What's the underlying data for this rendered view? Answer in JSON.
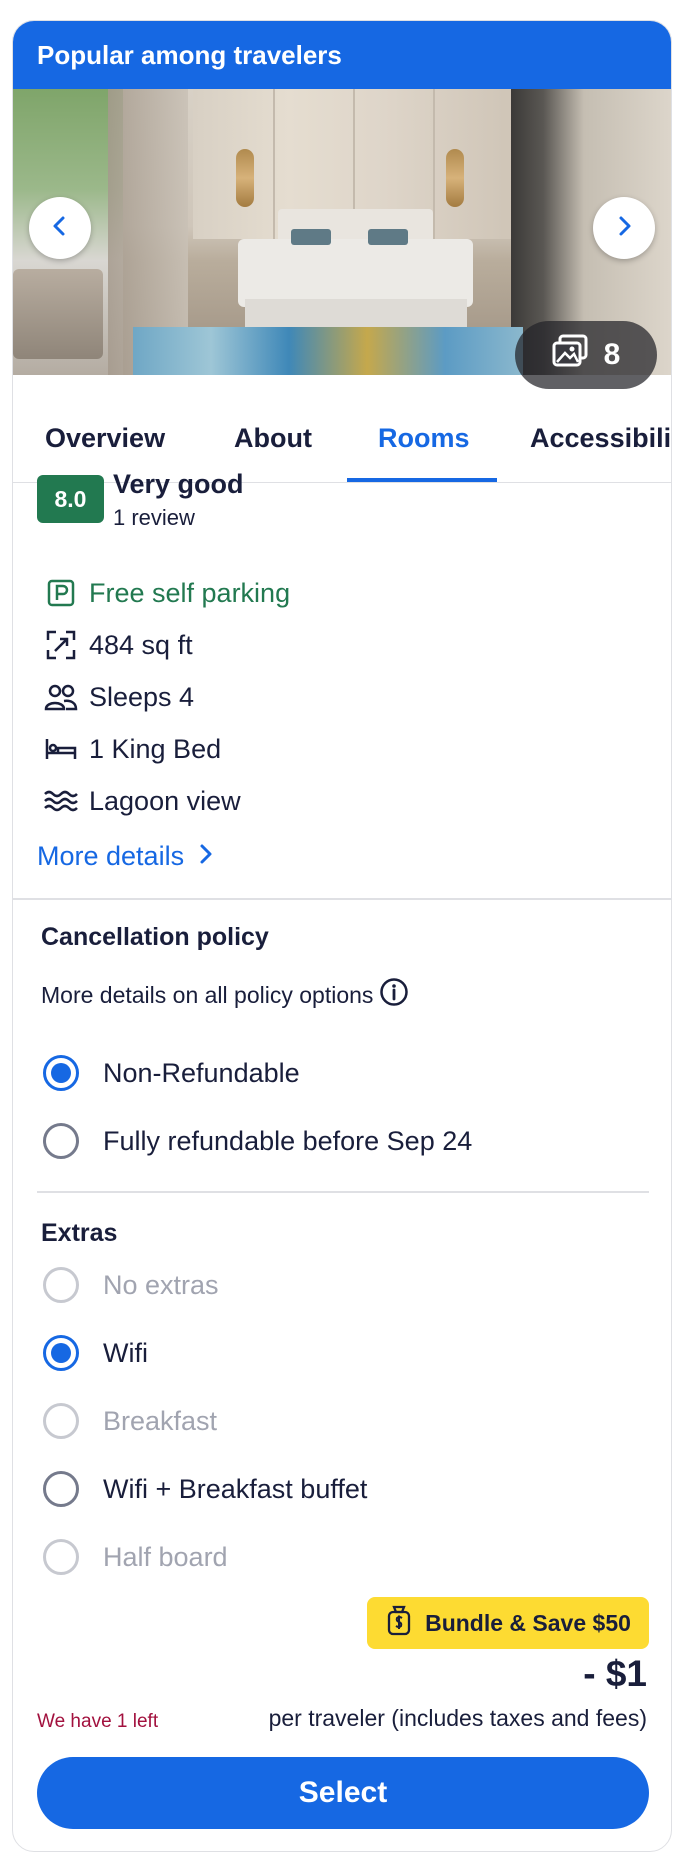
{
  "banner": {
    "title": "Popular among travelers"
  },
  "gallery": {
    "photo_count": "8",
    "prev_icon": "chevron-left-icon",
    "next_icon": "chevron-right-icon",
    "gallery_icon": "photo-gallery-icon"
  },
  "tabs": [
    {
      "label": "Overview",
      "active": false
    },
    {
      "label": "About",
      "active": false
    },
    {
      "label": "Rooms",
      "active": true
    },
    {
      "label": "Accessibility",
      "active": false
    }
  ],
  "rating": {
    "score": "8.0",
    "label": "Very good",
    "reviews": "1 review",
    "color": "#227950"
  },
  "features": [
    {
      "icon": "parking-icon",
      "label": "Free self parking",
      "highlight": true
    },
    {
      "icon": "expand-icon",
      "label": "484 sq ft",
      "highlight": false
    },
    {
      "icon": "people-icon",
      "label": "Sleeps 4",
      "highlight": false
    },
    {
      "icon": "bed-icon",
      "label": "1 King Bed",
      "highlight": false
    },
    {
      "icon": "waves-icon",
      "label": "Lagoon view",
      "highlight": false
    }
  ],
  "more_details": {
    "label": "More details"
  },
  "cancellation": {
    "title": "Cancellation policy",
    "link": "More details on all policy options",
    "options": [
      {
        "label": "Non-Refundable",
        "selected": true,
        "disabled": false
      },
      {
        "label": "Fully refundable before Sep 24",
        "selected": false,
        "disabled": false
      }
    ]
  },
  "extras": {
    "title": "Extras",
    "options": [
      {
        "label": "No extras",
        "selected": false,
        "disabled": true
      },
      {
        "label": "Wifi",
        "selected": true,
        "disabled": false
      },
      {
        "label": "Breakfast",
        "selected": false,
        "disabled": true
      },
      {
        "label": "Wifi + Breakfast buffet",
        "selected": false,
        "disabled": false
      },
      {
        "label": "Half board",
        "selected": false,
        "disabled": true
      }
    ]
  },
  "bundle": {
    "label": "Bundle & Save $50",
    "color": "#fddb32"
  },
  "price": {
    "amount": "- $1",
    "note": "per traveler (includes taxes and fees)",
    "availability": "We have 1 left"
  },
  "select_button": {
    "label": "Select",
    "color": "#1668e3"
  }
}
